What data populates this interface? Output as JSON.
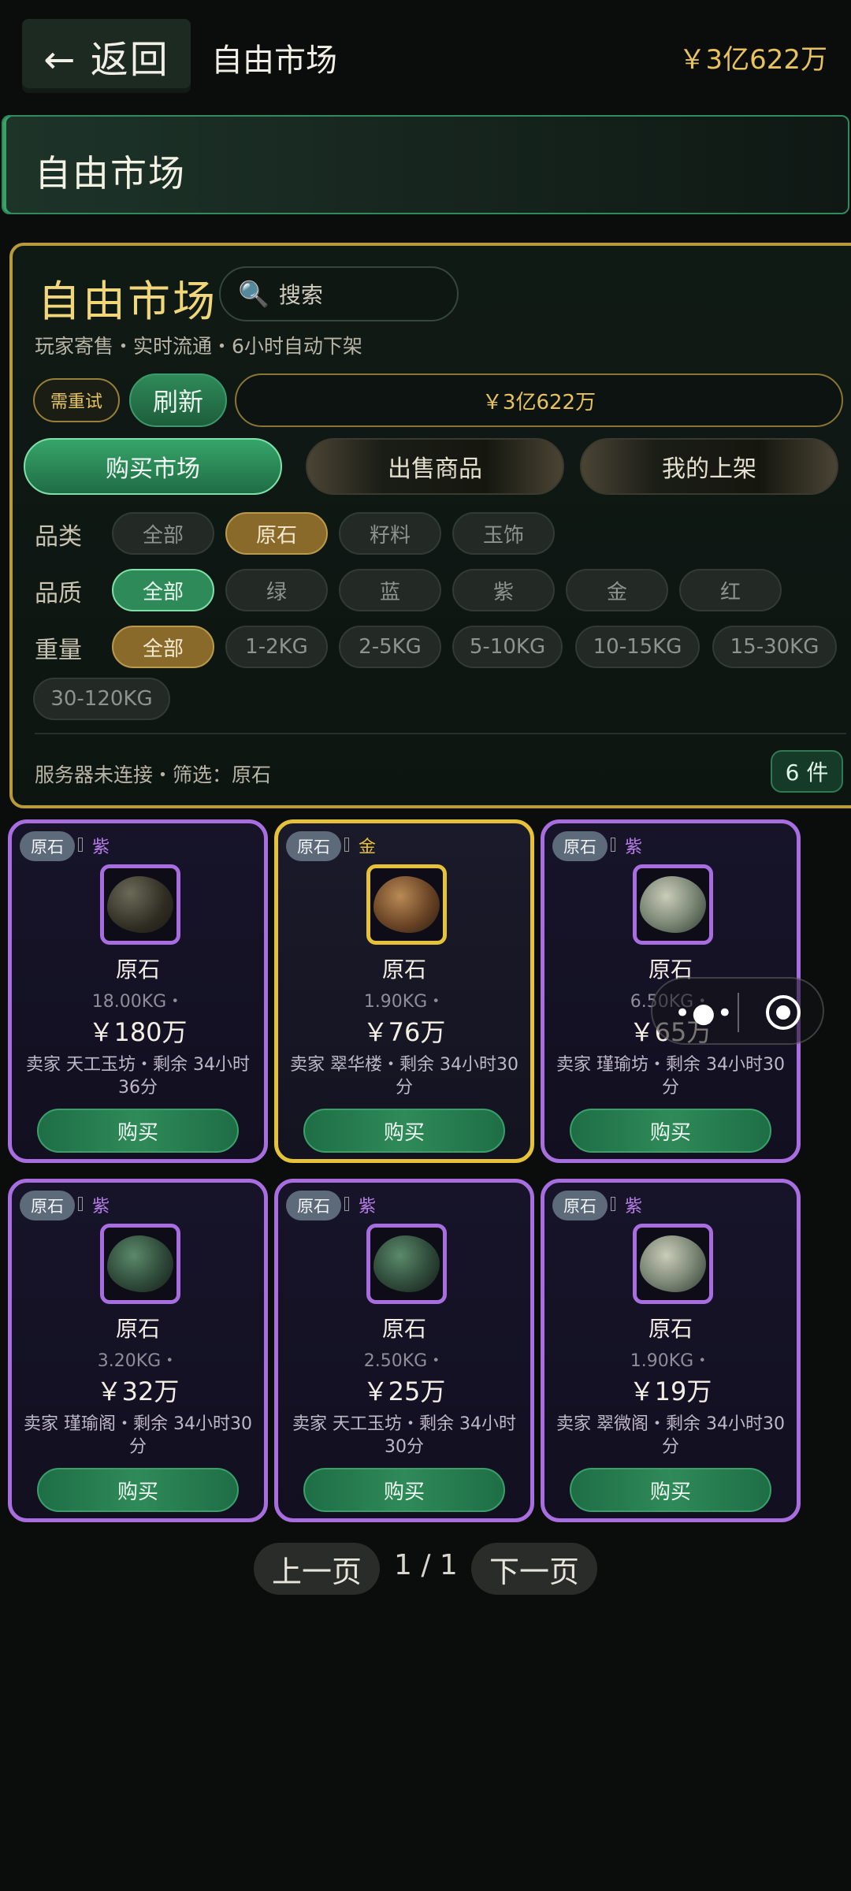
{
  "topbar": {
    "back_label": "← 返回",
    "title": "自由市场",
    "balance": "￥3亿622万"
  },
  "banner": {
    "title": "自由市场"
  },
  "panel": {
    "title": "自由市场",
    "search_placeholder": "搜索",
    "subtitle": "玩家寄售・实时流通・6小时自动下架",
    "retry_label": "需重试",
    "refresh_label": "刷新",
    "balance": "￥3亿622万",
    "tabs": [
      "购买市场",
      "出售商品",
      "我的上架"
    ],
    "filters": {
      "category_label": "品类",
      "categories": [
        "全部",
        "原石",
        "籽料",
        "玉饰"
      ],
      "quality_label": "品质",
      "qualities": [
        "全部",
        "绿",
        "蓝",
        "紫",
        "金",
        "红"
      ],
      "weight_label": "重量",
      "weights": [
        "全部",
        "1-2KG",
        "2-5KG",
        "5-10KG",
        "10-15KG",
        "15-30KG",
        "30-120KG"
      ]
    },
    "status": "服务器未连接・筛选：原石",
    "count": "6 件"
  },
  "cards": [
    {
      "tag": "原石",
      "quality": "紫",
      "quality_color": "#b77ee8",
      "name": "原石",
      "weight": "18.00KG・",
      "price": "￥180万",
      "seller": "卖家 天工玉坊・剩余 34小时36分",
      "buy": "购买"
    },
    {
      "tag": "原石",
      "quality": "金",
      "quality_color": "#e6c13a",
      "name": "原石",
      "weight": "1.90KG・",
      "price": "￥76万",
      "seller": "卖家 翠华楼・剩余 34小时30分",
      "buy": "购买"
    },
    {
      "tag": "原石",
      "quality": "紫",
      "quality_color": "#b77ee8",
      "name": "原石",
      "weight": "6.50KG・",
      "price": "￥65万",
      "seller": "卖家 瑾瑜坊・剩余 34小时30分",
      "buy": "购买"
    },
    {
      "tag": "原石",
      "quality": "紫",
      "quality_color": "#b77ee8",
      "name": "原石",
      "weight": "3.20KG・",
      "price": "￥32万",
      "seller": "卖家 瑾瑜阁・剩余 34小时30分",
      "buy": "购买"
    },
    {
      "tag": "原石",
      "quality": "紫",
      "quality_color": "#b77ee8",
      "name": "原石",
      "weight": "2.50KG・",
      "price": "￥25万",
      "seller": "卖家 天工玉坊・剩余 34小时30分",
      "buy": "购买"
    },
    {
      "tag": "原石",
      "quality": "紫",
      "quality_color": "#b77ee8",
      "name": "原石",
      "weight": "1.90KG・",
      "price": "￥19万",
      "seller": "卖家 翠微阁・剩余 34小时30分",
      "buy": "购买"
    }
  ],
  "pagination": {
    "prev": "上一页",
    "page": "1 / 1",
    "next": "下一页"
  },
  "colors": {
    "accent_green": "#2f8a59",
    "gold": "#e8c25a",
    "purple": "#a86ee0"
  }
}
